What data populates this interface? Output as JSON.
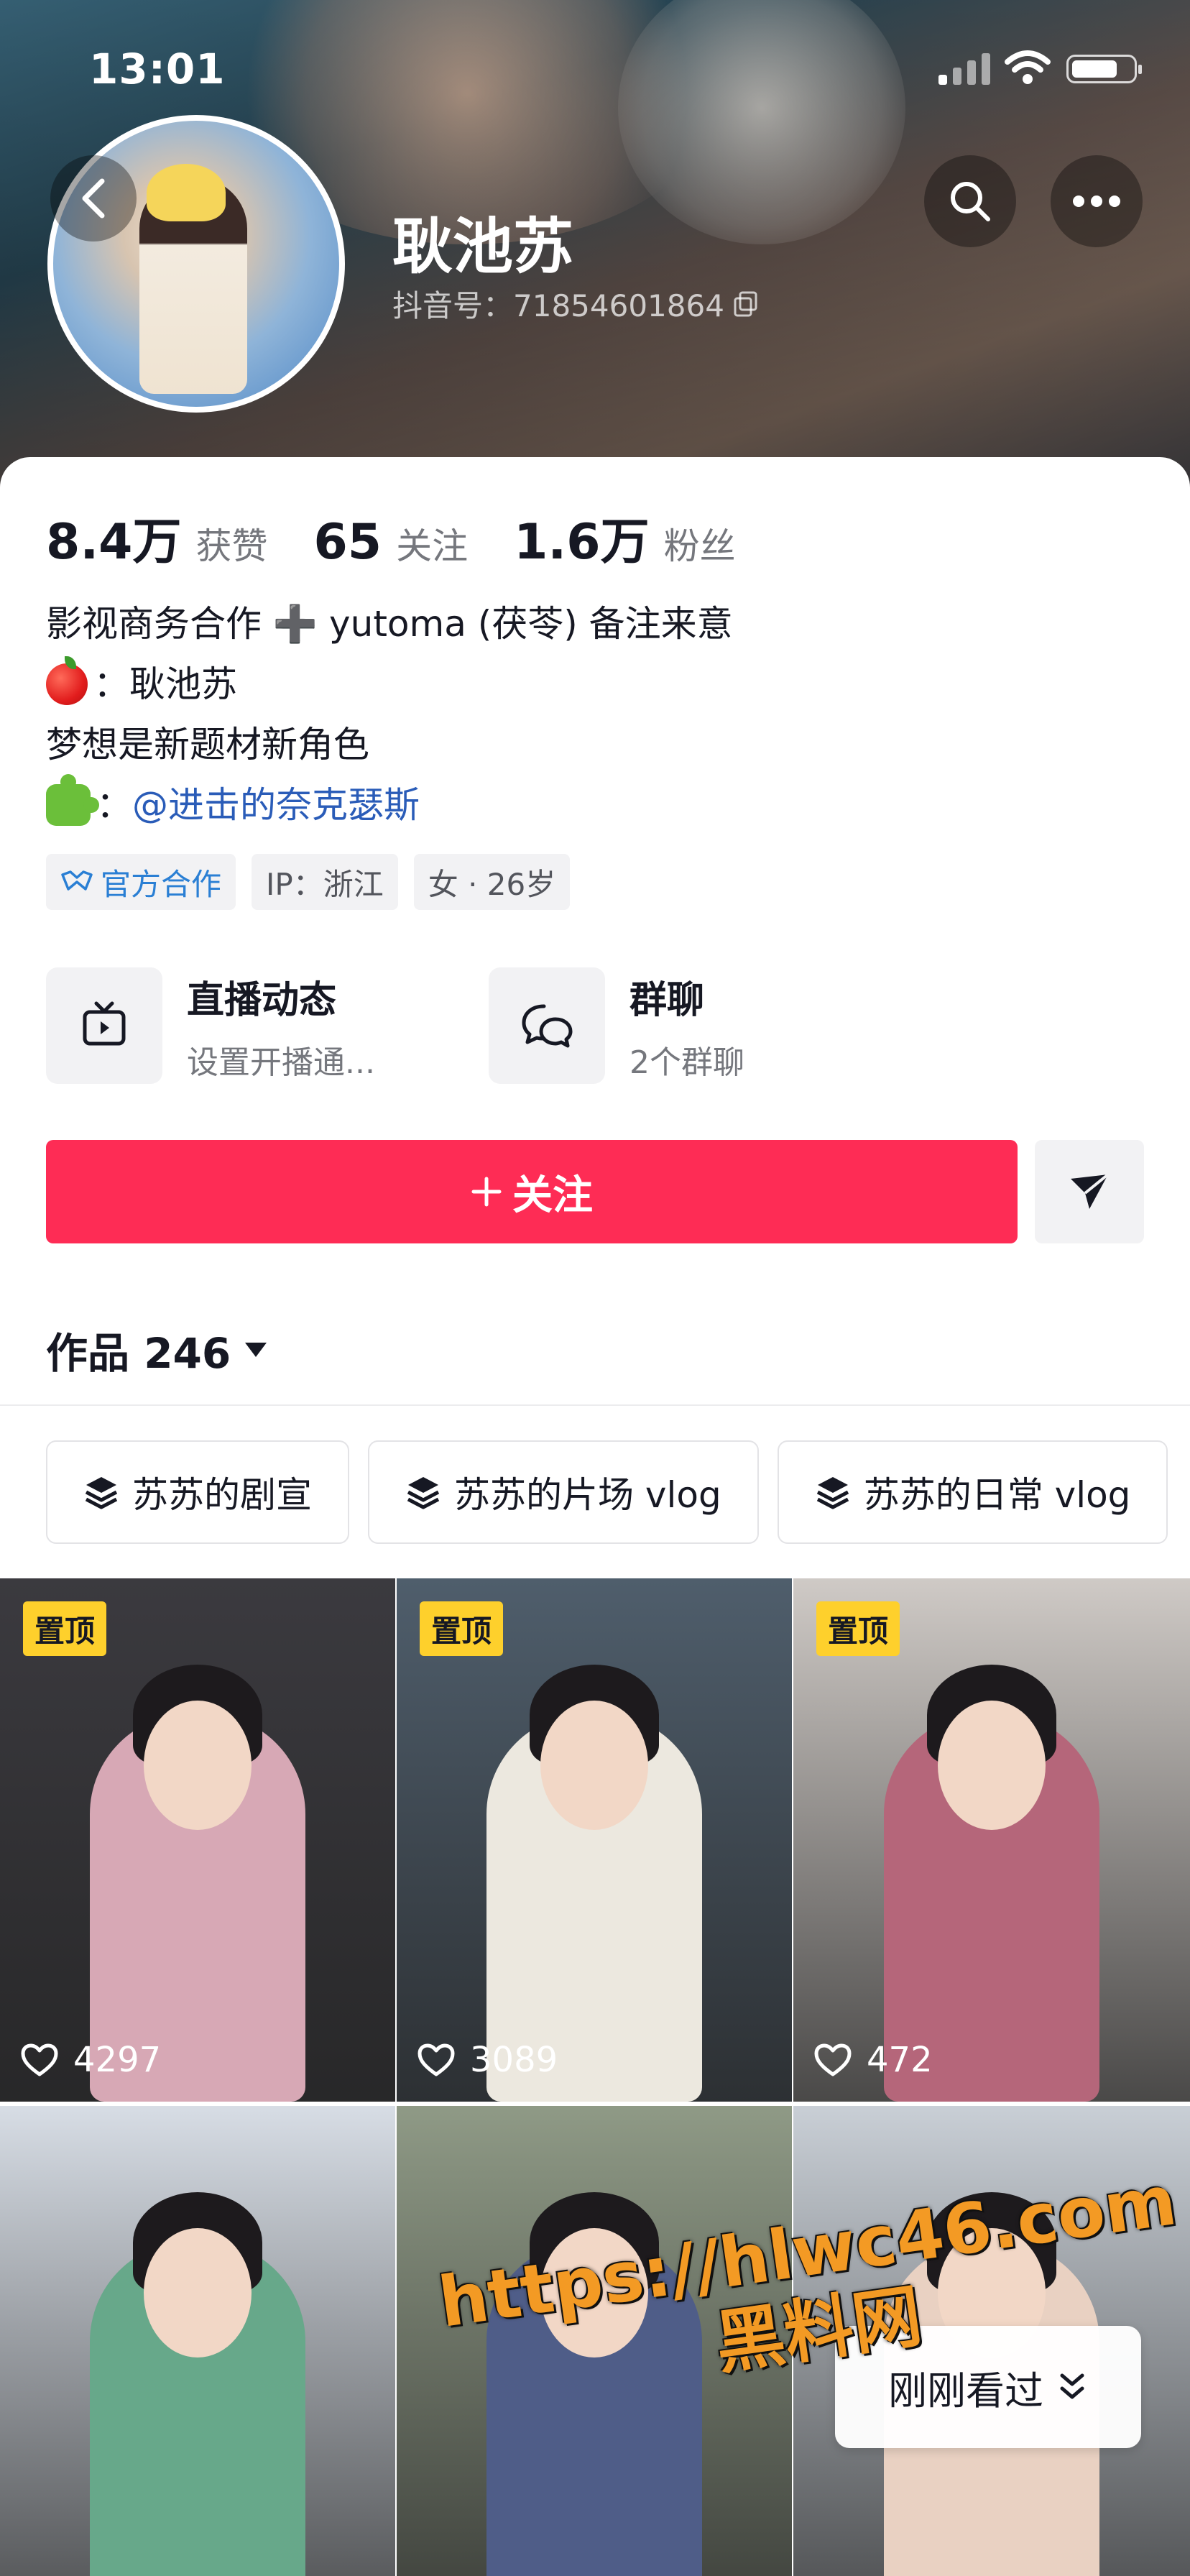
{
  "status_bar": {
    "time": "13:01"
  },
  "profile": {
    "nickname": "耿池苏",
    "douyin_id": "抖音号：71854601864"
  },
  "stats": [
    {
      "num": "8.4万",
      "label": "获赞"
    },
    {
      "num": "65",
      "label": "关注"
    },
    {
      "num": "1.6万",
      "label": "粉丝"
    }
  ],
  "bio": {
    "line1": "影视商务合作 ➕ yutoma (茯苓) 备注来意",
    "line2": "：耿池苏",
    "line3": "梦想是新题材新角色",
    "line4_prefix": "：",
    "line4_mention": "@进击的奈克瑟斯"
  },
  "tags": [
    "官方合作",
    "IP：浙江",
    "女 · 26岁"
  ],
  "features": [
    {
      "title": "直播动态",
      "sub": "设置开播通..."
    },
    {
      "title": "群聊",
      "sub": "2个群聊"
    }
  ],
  "follow_label": "关注",
  "works_label": "作品 246",
  "collections": [
    "苏苏的剧宣",
    "苏苏的片场 vlog",
    "苏苏的日常 vlog"
  ],
  "videos": [
    {
      "pinned": "置顶",
      "likes": "4297",
      "bg": "#3b3a3f",
      "outfit": "#d7a8b5"
    },
    {
      "pinned": "置顶",
      "likes": "3089",
      "bg": "#4f5e6c",
      "outfit": "#ece8df"
    },
    {
      "pinned": "置顶",
      "likes": "472",
      "bg": "#cfcac6",
      "outfit": "#b5667a"
    },
    {
      "pinned": "",
      "likes": "",
      "bg": "#d7dde5",
      "outfit": "#67a88a"
    },
    {
      "pinned": "",
      "likes": "",
      "bg": "#8f9a86",
      "outfit": "#4f5d88"
    },
    {
      "pinned": "",
      "likes": "",
      "bg": "#c9cfd6",
      "outfit": "#e9d1c2"
    }
  ],
  "recently_viewed": "刚刚看过",
  "watermark": {
    "url": "https://hlwc46.com",
    "name": "黑料网"
  },
  "colors": {
    "accent": "#fe2c55",
    "pin_badge": "#fed02c",
    "mention": "#2a5cb8"
  }
}
